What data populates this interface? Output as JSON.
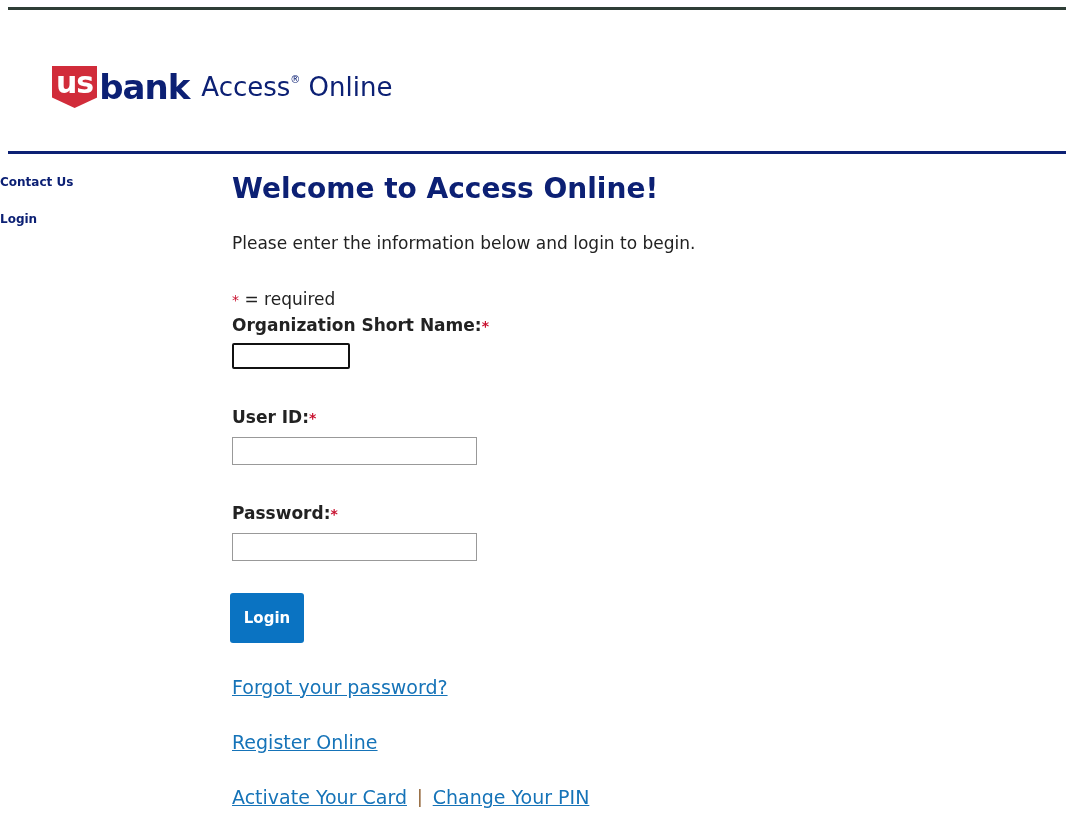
{
  "header": {
    "logo": {
      "mark": "us",
      "word": "bank"
    },
    "product": "Access$^{®}$ Online"
  },
  "sidebar": {
    "items": [
      {
        "label": "Contact Us"
      },
      {
        "label": "Login"
      }
    ]
  },
  "main": {
    "title": "Welcome to Access Online!",
    "intro": "Please enter the information below and login to begin.",
    "required_note": {
      "mark": "*",
      "text": "= required"
    },
    "fields": [
      {
        "label": "Organization Short Name:",
        "required_mark": "*",
        "focused": true
      },
      {
        "label": "User ID:",
        "required_mark": "*",
        "focused": false
      },
      {
        "label": "Password:",
        "required_mark": "*",
        "focused": false
      }
    ],
    "button": "Login",
    "links": [
      {
        "items": [
          "Forgot your password?"
        ]
      },
      {
        "items": [
          "Register Online"
        ]
      },
      {
        "items": [
          "Activate Your Card",
          "Change Your PIN"
        ],
        "separator": "|"
      }
    ]
  }
}
